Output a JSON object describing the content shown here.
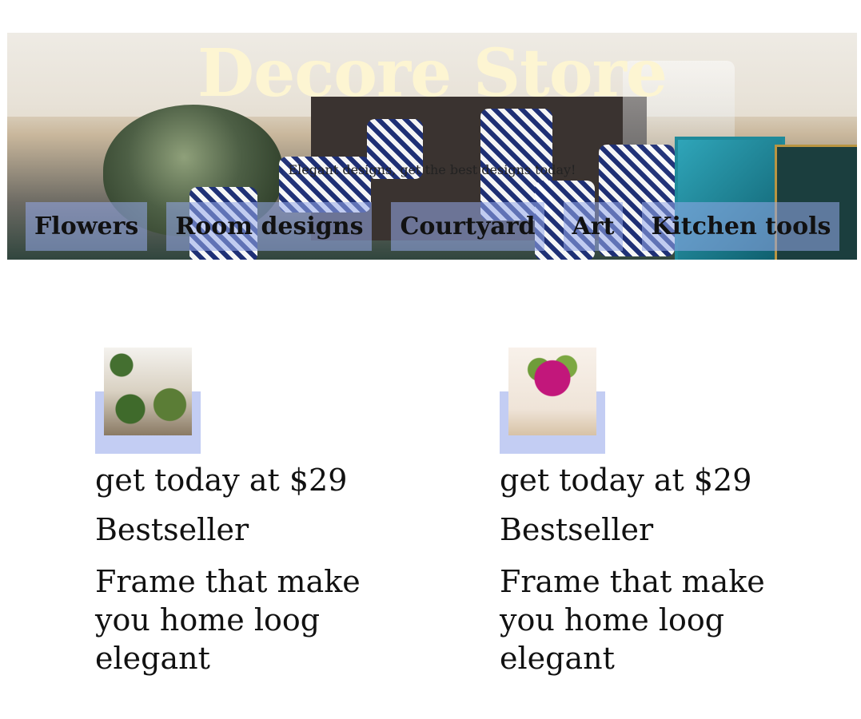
{
  "header": {
    "title": "Decore Store",
    "tagline": "Elegant designs, get the best designs today!"
  },
  "nav": {
    "items": [
      {
        "label": "Flowers"
      },
      {
        "label": "Room designs"
      },
      {
        "label": "Courtyard"
      },
      {
        "label": "Art"
      },
      {
        "label": "Kitchen tools"
      }
    ]
  },
  "products": [
    {
      "image": "courtyard-garden-photo",
      "price": "get today at $29",
      "badge": "Bestseller",
      "description": "Frame that make you home loog elegant"
    },
    {
      "image": "flower-vase-photo",
      "price": "get today at $29",
      "badge": "Bestseller",
      "description": "Frame that make you home loog elegant"
    }
  ],
  "colors": {
    "title": "#fdf5d2",
    "nav_bg": "#96aaeb",
    "thumb_accent": "#c3cdf3"
  }
}
